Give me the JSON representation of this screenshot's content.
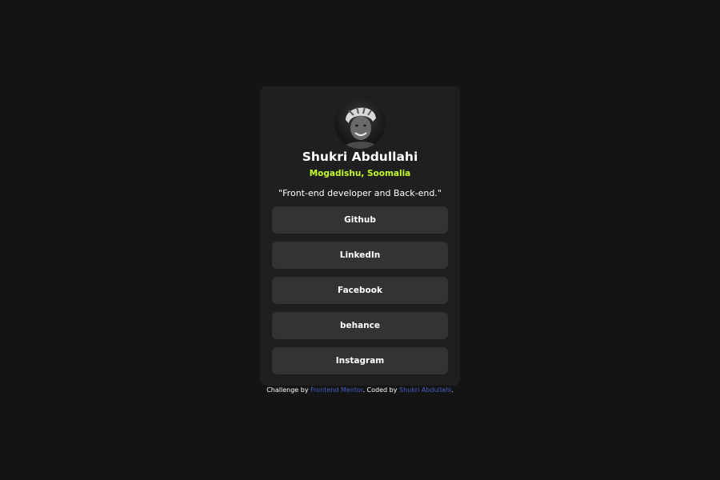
{
  "profile": {
    "name": "Shukri Abdullahi",
    "location": "Mogadishu, Soomalia",
    "bio": "\"Front-end developer and Back-end.\""
  },
  "links": [
    {
      "label": "Github"
    },
    {
      "label": "LinkedIn"
    },
    {
      "label": "Facebook"
    },
    {
      "label": "behance"
    },
    {
      "label": "Instagram"
    }
  ],
  "footer": {
    "prefix": "Challenge by ",
    "mentor_link": "Frontend Mentor",
    "middle": ". Coded by ",
    "author_link": "Shukri Abdullahi",
    "suffix": "."
  },
  "colors": {
    "background": "#141414",
    "card": "#1f1f1f",
    "button": "#333333",
    "accent": "#c4f82a",
    "link": "#4a5cc9"
  }
}
